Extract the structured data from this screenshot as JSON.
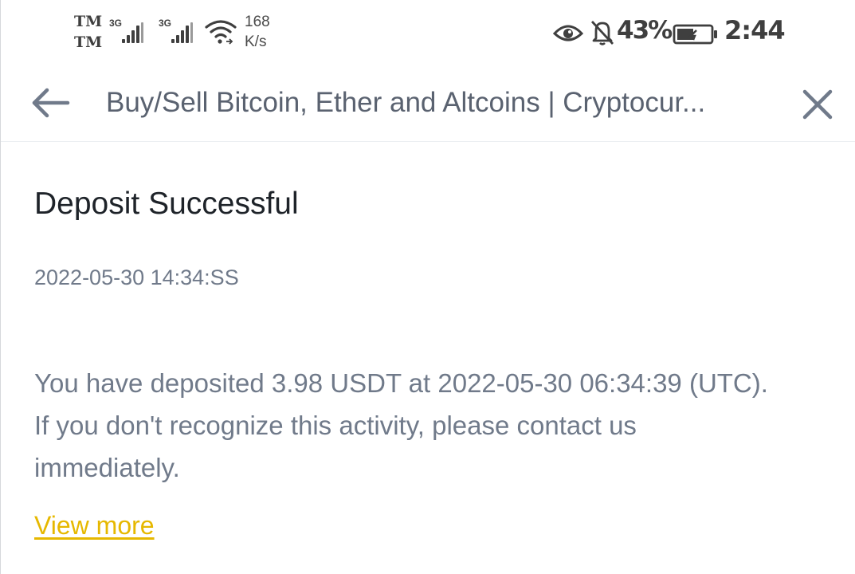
{
  "status_bar": {
    "carrier_1": "TM",
    "carrier_2": "TM",
    "sim1_network": "3G",
    "sim2_network": "3G",
    "net_speed_value": "168",
    "net_speed_unit": "K/s",
    "battery_percent": "43%",
    "time": "2:44",
    "icons": [
      "signal-icon",
      "wifi-icon",
      "eye-icon",
      "bell-off-icon",
      "battery-icon"
    ]
  },
  "toolbar": {
    "title": "Buy/Sell Bitcoin, Ether and Altcoins | Cryptocur...",
    "back_icon": "arrow-left-icon",
    "close_icon": "close-icon"
  },
  "notification": {
    "title": "Deposit Successful",
    "timestamp": "2022-05-30 14:34:SS",
    "body_line_1": "You have deposited 3.98 USDT at 2022-05-30 06:34:39 (UTC).",
    "body_line_2": "If you don't recognize this activity, please contact us",
    "body_line_3": "immediately.",
    "view_more_label": "View more"
  },
  "colors": {
    "title_text": "#1e2329",
    "secondary_text": "#707a8a",
    "link_accent": "#e6b800",
    "toolbar_text": "#5a6270"
  }
}
